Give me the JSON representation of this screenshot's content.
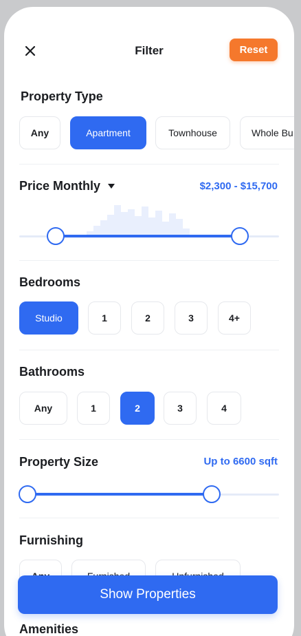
{
  "header": {
    "title": "Filter",
    "reset_label": "Reset"
  },
  "property_type": {
    "title": "Property Type",
    "options": [
      "Any",
      "Apartment",
      "Townhouse",
      "Whole Bu"
    ],
    "selected": "Apartment"
  },
  "price": {
    "title": "Price Monthly",
    "range_text": "$2,300 - $15,700",
    "slider_low": 0.14,
    "slider_high": 0.85
  },
  "bedrooms": {
    "title": "Bedrooms",
    "options": [
      "Studio",
      "1",
      "2",
      "3",
      "4+"
    ],
    "selected": "Studio"
  },
  "bathrooms": {
    "title": "Bathrooms",
    "options": [
      "Any",
      "1",
      "2",
      "3",
      "4"
    ],
    "selected": "2"
  },
  "property_size": {
    "title": "Property Size",
    "value_text": "Up to 6600 sqft",
    "slider_low": 0.0,
    "slider_high": 0.74
  },
  "furnishing": {
    "title": "Furnishing",
    "options": [
      "Any",
      "Furnished",
      "Unfurnished"
    ]
  },
  "amenities": {
    "title": "Amenities"
  },
  "cta": {
    "label": "Show Properties"
  },
  "colors": {
    "accent": "#2f6af1",
    "reset": "#f5782c",
    "text": "#1b1d21"
  }
}
